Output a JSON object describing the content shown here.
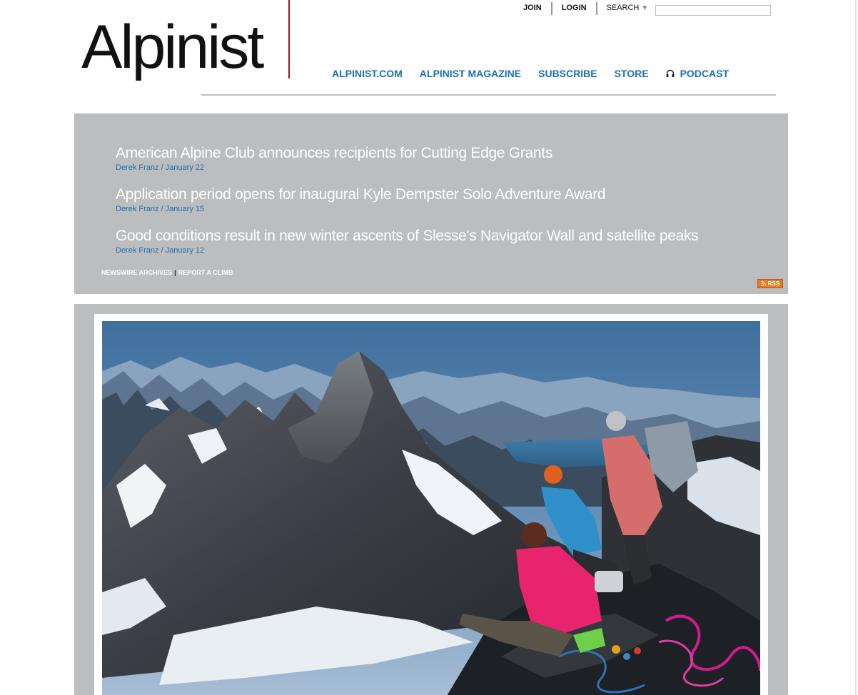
{
  "header": {
    "logo_text": "Alpinist",
    "utility_nav": {
      "join": "JOIN",
      "login": "LOGIN",
      "search": "SEARCH"
    },
    "search_placeholder": "",
    "main_nav": [
      {
        "label": "ALPINIST.COM"
      },
      {
        "label": "ALPINIST MAGAZINE"
      },
      {
        "label": "SUBSCRIBE"
      },
      {
        "label": "STORE"
      },
      {
        "label": "PODCAST",
        "icon": "headphones-icon"
      }
    ]
  },
  "newswire": {
    "items": [
      {
        "title": "American Alpine Club announces recipients for Cutting Edge Grants",
        "meta": "Derek Franz / January 22"
      },
      {
        "title": "Application period opens for inaugural Kyle Dempster Solo Adventure Award",
        "meta": "Derek Franz / January 15"
      },
      {
        "title": "Good conditions result in new winter ascents of Slesse's Navigator Wall and satellite peaks",
        "meta": "Derek Franz / January 12"
      }
    ],
    "archives_label": "NEWSWIRE ARCHIVES",
    "separator": "|",
    "report_label": "REPORT A CLIMB",
    "rss_label": "RSS"
  },
  "colors": {
    "link_blue": "#1a6fb6",
    "panel_gray": "#bcbdbf",
    "logo_accent": "#a3181e",
    "rss_orange": "#e37a25"
  }
}
